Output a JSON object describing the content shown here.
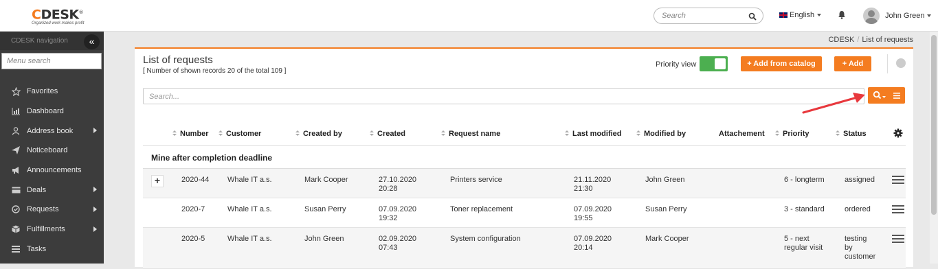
{
  "app": {
    "logo_text": "DESK",
    "logo_c": "C",
    "logo_reg": "®",
    "logo_tagline": "Organized work makes profit"
  },
  "header": {
    "search_placeholder": "Search",
    "language": "English",
    "user_name": "John Green"
  },
  "sidebar": {
    "title": "CDESK navigation",
    "collapse_glyph": "«",
    "search_placeholder": "Menu search",
    "items": [
      {
        "label": "Favorites",
        "icon": "star-icon",
        "has_sub": false
      },
      {
        "label": "Dashboard",
        "icon": "chart-icon",
        "has_sub": false
      },
      {
        "label": "Address book",
        "icon": "person-icon",
        "has_sub": true
      },
      {
        "label": "Noticeboard",
        "icon": "paper-plane-icon",
        "has_sub": false
      },
      {
        "label": "Announcements",
        "icon": "megaphone-icon",
        "has_sub": false
      },
      {
        "label": "Deals",
        "icon": "card-icon",
        "has_sub": true
      },
      {
        "label": "Requests",
        "icon": "check-circle-icon",
        "has_sub": true
      },
      {
        "label": "Fulfillments",
        "icon": "box-icon",
        "has_sub": true
      },
      {
        "label": "Tasks",
        "icon": "list-icon",
        "has_sub": false
      }
    ]
  },
  "breadcrumb": {
    "root": "CDESK",
    "separator": "/",
    "current": "List of requests"
  },
  "page": {
    "title": "List of requests",
    "subtitle": "[ Number of shown records 20 of the total 109 ]",
    "priority_view_label": "Priority view",
    "priority_view_on": true,
    "add_from_catalog_label": "+ Add from catalog",
    "add_label": "+ Add",
    "search_placeholder": "Search..."
  },
  "table": {
    "columns": [
      "Number",
      "Customer",
      "Created by",
      "Created",
      "Request name",
      "Last modified",
      "Modified by",
      "Attachement",
      "Priority",
      "Status"
    ],
    "group_label": "Mine after completion deadline",
    "expand_glyph": "+",
    "rows": [
      {
        "number": "2020-44",
        "customer": "Whale IT a.s.",
        "created_by": "Mark Cooper",
        "created_date": "27.10.2020",
        "created_time": "20:28",
        "name": "Printers service",
        "modified_date": "21.11.2020",
        "modified_time": "21:30",
        "modified_by": "John Green",
        "priority_1": "6 - longterm",
        "priority_2": "",
        "status_1": "assigned",
        "status_2": "",
        "status_3": ""
      },
      {
        "number": "2020-7",
        "customer": "Whale IT a.s.",
        "created_by": "Susan Perry",
        "created_date": "07.09.2020",
        "created_time": "19:32",
        "name": "Toner replacement",
        "modified_date": "07.09.2020",
        "modified_time": "19:55",
        "modified_by": "Susan Perry",
        "priority_1": "3 - standard",
        "priority_2": "",
        "status_1": "ordered",
        "status_2": "",
        "status_3": ""
      },
      {
        "number": "2020-5",
        "customer": "Whale IT a.s.",
        "created_by": "John Green",
        "created_date": "02.09.2020",
        "created_time": "07:43",
        "name": "System configuration",
        "modified_date": "07.09.2020",
        "modified_time": "20:14",
        "modified_by": "Mark Cooper",
        "priority_1": "5 - next",
        "priority_2": "regular visit",
        "status_1": "testing",
        "status_2": "by",
        "status_3": "customer"
      }
    ]
  },
  "colors": {
    "accent": "#f47c20",
    "toggle_on": "#4caf50",
    "sidebar_bg": "#3c3c3c",
    "annotation_arrow": "#e8383d"
  }
}
